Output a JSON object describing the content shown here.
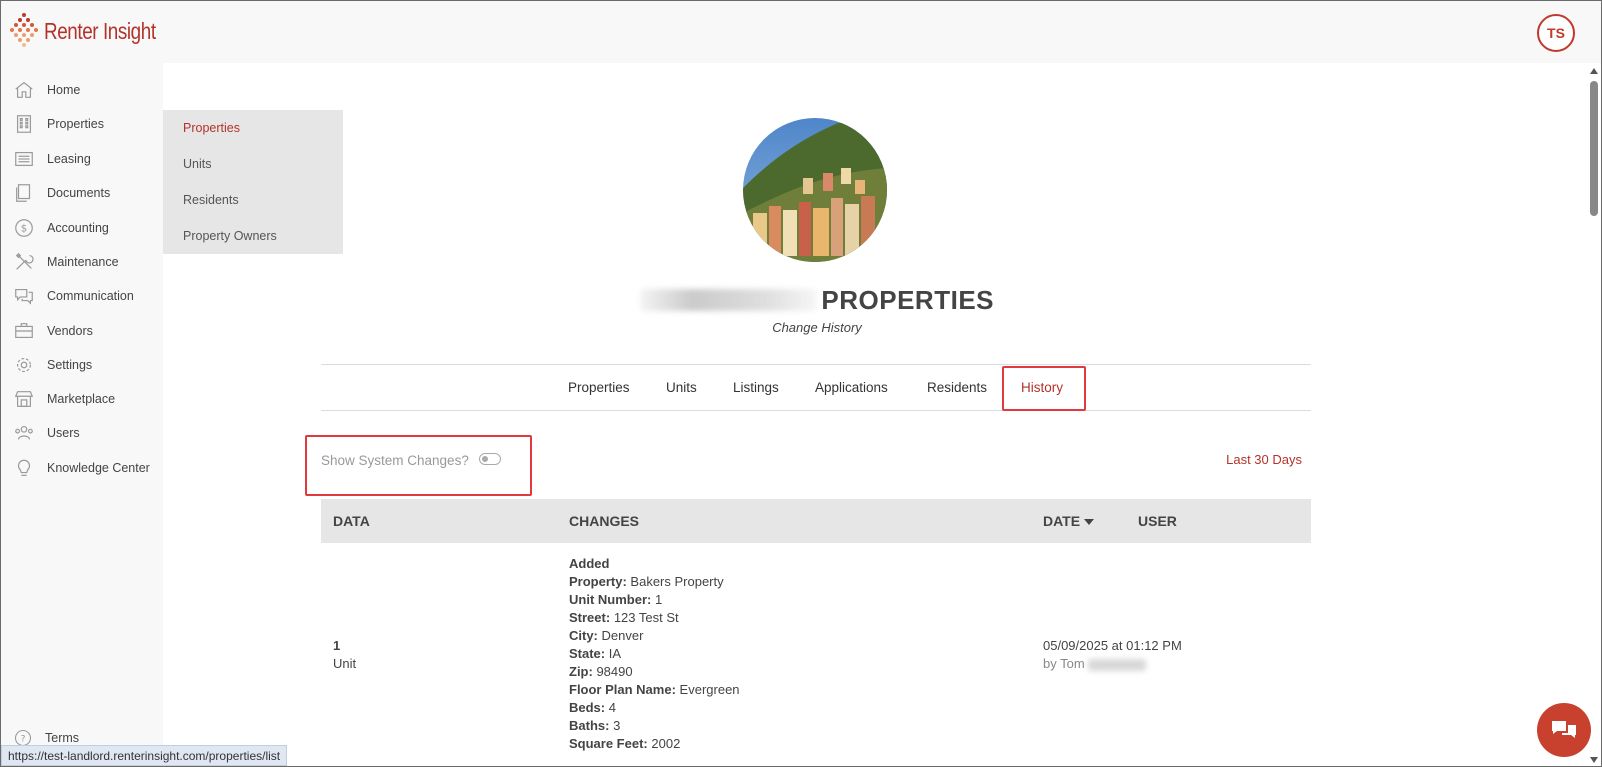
{
  "app": {
    "logo_text": "Renter Insight",
    "user_initials": "TS",
    "status_url": "https://test-landlord.renterinsight.com/properties/list"
  },
  "sidebar": {
    "items": [
      {
        "label": "Home",
        "icon": "home-icon"
      },
      {
        "label": "Properties",
        "icon": "building-icon"
      },
      {
        "label": "Leasing",
        "icon": "list-icon"
      },
      {
        "label": "Documents",
        "icon": "documents-icon"
      },
      {
        "label": "Accounting",
        "icon": "dollar-icon"
      },
      {
        "label": "Maintenance",
        "icon": "tools-icon"
      },
      {
        "label": "Communication",
        "icon": "chat-icon"
      },
      {
        "label": "Vendors",
        "icon": "briefcase-icon"
      },
      {
        "label": "Settings",
        "icon": "gear-icon"
      },
      {
        "label": "Marketplace",
        "icon": "store-icon"
      },
      {
        "label": "Users",
        "icon": "users-icon"
      },
      {
        "label": "Knowledge Center",
        "icon": "lightbulb-icon"
      }
    ],
    "terms_label": "Terms"
  },
  "submenu": {
    "items": [
      "Properties",
      "Units",
      "Residents",
      "Property Owners"
    ]
  },
  "main": {
    "title": "PROPERTIES",
    "subtitle": "Change History",
    "tabs": [
      "Properties",
      "Units",
      "Listings",
      "Applications",
      "Residents",
      "History"
    ],
    "active_tab": "History",
    "toggle_label": "Show System Changes?",
    "toggle_on": false,
    "range_label": "Last 30 Days"
  },
  "table": {
    "headers": {
      "data": "DATA",
      "changes": "CHANGES",
      "date": "DATE",
      "user": "USER"
    },
    "row": {
      "data_value": "1",
      "data_type": "Unit",
      "action": "Added",
      "changes": [
        {
          "label": "Property:",
          "value": "Bakers Property"
        },
        {
          "label": "Unit Number:",
          "value": "1"
        },
        {
          "label": "Street:",
          "value": "123 Test St"
        },
        {
          "label": "City:",
          "value": "Denver"
        },
        {
          "label": "State:",
          "value": "IA"
        },
        {
          "label": "Zip:",
          "value": "98490"
        },
        {
          "label": "Floor Plan Name:",
          "value": "Evergreen"
        },
        {
          "label": "Beds:",
          "value": "4"
        },
        {
          "label": "Baths:",
          "value": "3"
        },
        {
          "label": "Square Feet:",
          "value": "2002"
        }
      ],
      "date": "05/09/2025 at 01:12 PM",
      "by": "by Tom"
    }
  },
  "colors": {
    "brand_red": "#b3332b",
    "highlight_red": "#e0393e",
    "sidebar_bg": "#f8f8f8",
    "submenu_bg": "#e6e6e6"
  }
}
